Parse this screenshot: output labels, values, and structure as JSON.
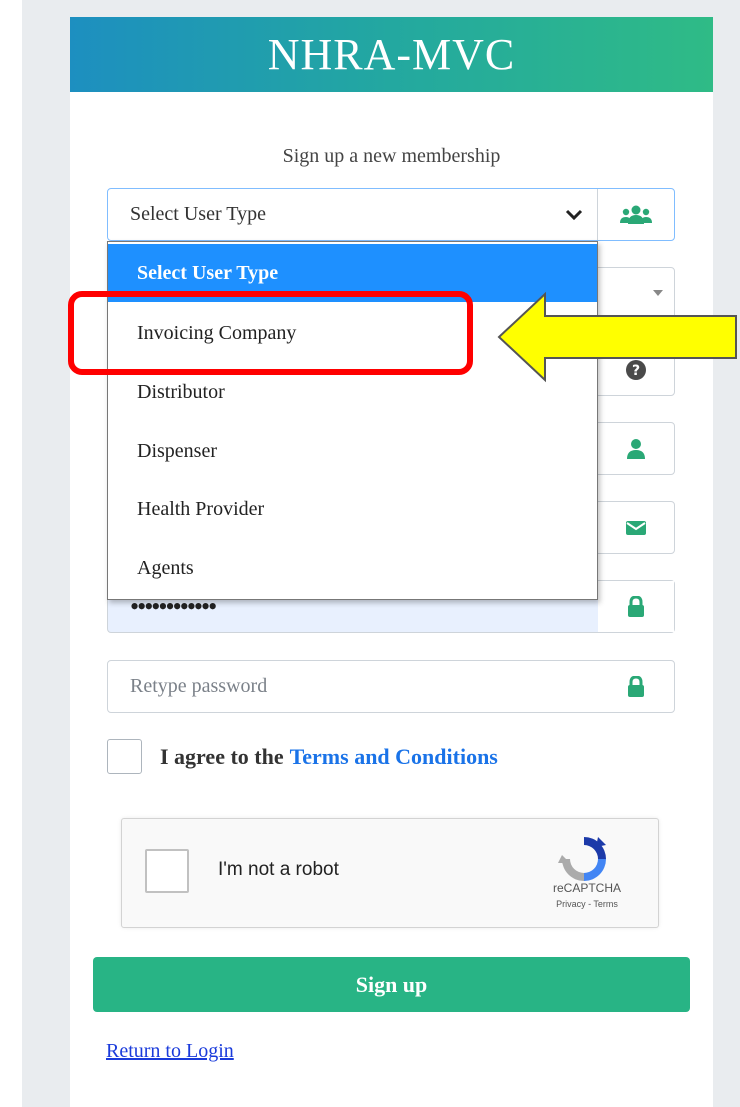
{
  "brand": {
    "title": "NHRA-MVC"
  },
  "form": {
    "subtitle": "Sign up a new membership",
    "user_type_select": {
      "value": "Select User Type",
      "icon": "users-icon"
    },
    "password_dots": "••••••••••••",
    "retype_placeholder": "Retype password",
    "agree_text": "I agree to the",
    "terms_link": "Terms and Conditions",
    "signup_label": "Sign up",
    "return_link": "Return to Login"
  },
  "dropdown": {
    "options": [
      "Select User Type",
      "Invoicing Company",
      "Distributor",
      "Dispenser",
      "Health Provider",
      "Agents"
    ],
    "selected": "Select User Type"
  },
  "recaptcha": {
    "label": "I'm not a robot",
    "brand": "reCAPTCHA",
    "terms": "Privacy - Terms"
  },
  "colors": {
    "header_start": "#1d8fc0",
    "header_end": "#2fbb86",
    "accent_green": "#28b485",
    "select_highlight": "#1e90ff",
    "annotation_red": "#ff0000",
    "annotation_yellow": "#ffff00"
  }
}
